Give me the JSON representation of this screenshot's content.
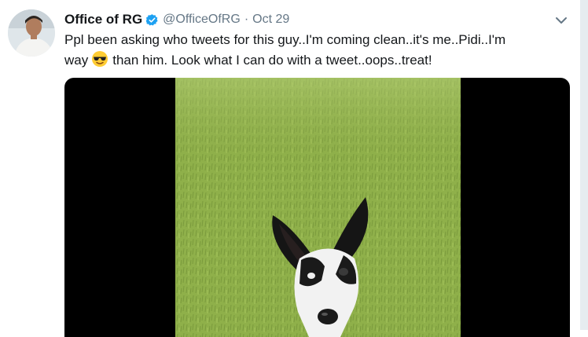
{
  "tweet": {
    "display_name": "Office of RG",
    "handle": "@OfficeOfRG",
    "separator": "·",
    "date": "Oct 29",
    "text_line1": "Ppl been asking who tweets for this guy..I'm coming clean..it's me..Pidi..I'm",
    "text_line2_prefix": "way",
    "text_line2_suffix": "than him.  Look what I can do with a tweet..oops..treat!",
    "emoji": "smiling-face-with-sunglasses"
  },
  "colors": {
    "verified": "#1da1f2",
    "secondary_text": "#657786",
    "grass": "#8fae4a",
    "video_bg": "#000000"
  },
  "icons": {
    "verified": "verified-badge-icon",
    "caret": "chevron-down-icon",
    "emoji": "sunglasses-emoji-icon"
  }
}
